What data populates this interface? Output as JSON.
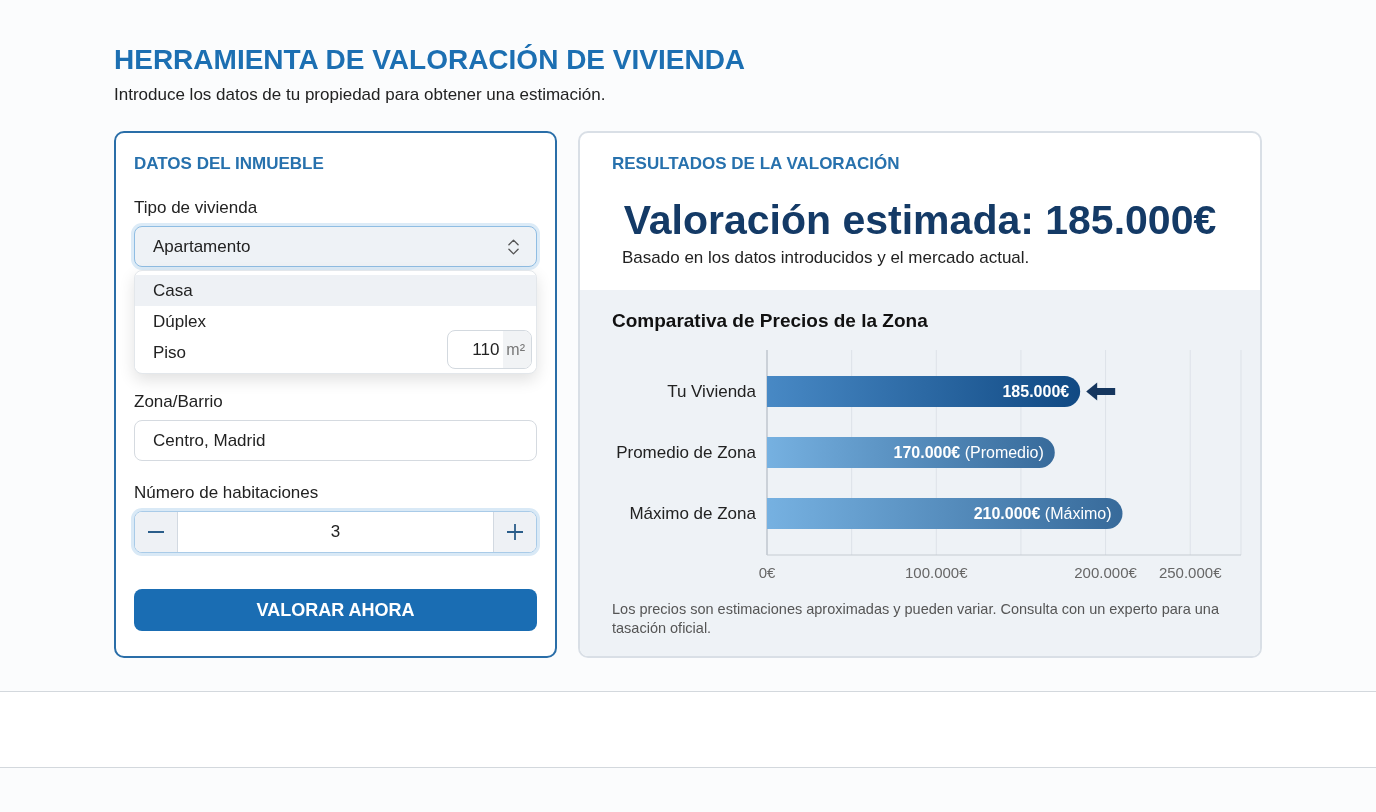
{
  "header": {
    "title": "HERRAMIENTA DE VALORACIÓN DE VIVIENDA",
    "subtitle": "Introduce los datos de tu propiedad para obtener una estimación."
  },
  "form_panel": {
    "title": "DATOS DEL INMUEBLE",
    "property_type": {
      "label": "Tipo de vivienda",
      "value": "Apartamento",
      "expanded": true,
      "options": [
        {
          "label": "Casa",
          "selected": true
        },
        {
          "label": "Dúplex",
          "selected": false
        },
        {
          "label": "Piso",
          "selected": false
        }
      ]
    },
    "area_field": {
      "value": "110",
      "unit": "m²"
    },
    "zone": {
      "label": "Zona/Barrio",
      "value": "Centro, Madrid"
    },
    "rooms": {
      "label": "Número de habitaciones",
      "value": "3"
    },
    "submit_button": "VALORAR AHORA"
  },
  "results_panel": {
    "title": "RESULTADOS DE LA VALORACIÓN",
    "estimate": "Valoración estimada: 185.000€",
    "basis": "Basado en los datos introducidos y el mercado actual.",
    "chart_data": {
      "type": "bar",
      "orientation": "horizontal",
      "title": "Comparativa de Precios de la Zona",
      "categories": [
        "Tu Vivienda",
        "Promedio de Zona",
        "Máximo de Zona"
      ],
      "series": [
        {
          "color": "#1462ad",
          "values": [
            185000,
            null,
            null
          ]
        },
        {
          "color": "#5b9fd8",
          "values": [
            null,
            170000,
            210000
          ]
        }
      ],
      "xlim": [
        0,
        280000
      ],
      "xticks": [
        {
          "value": 0,
          "label": "0€"
        },
        {
          "value": 100000,
          "label": "100.000€"
        },
        {
          "value": 200000,
          "label": "200.000€"
        },
        {
          "value": 250000,
          "label": "250.000€"
        }
      ],
      "grid": true,
      "value_labels": [
        "185.000€",
        "**170.000€** (Promedio)",
        "**210.000€** (Máximo)"
      ]
    },
    "disclaimer": "Los precios son estimaciones aproximadas y pueden variar. Consulta con un experto para una tasación oficial."
  }
}
